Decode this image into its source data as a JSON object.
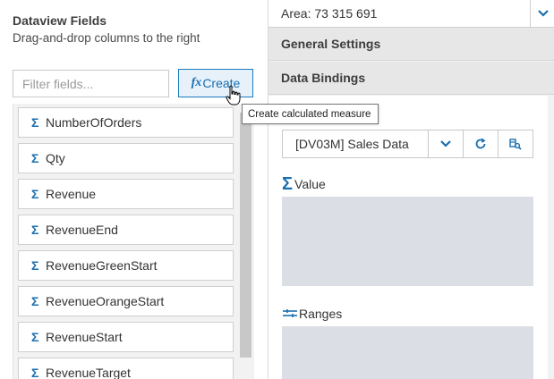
{
  "left": {
    "title": "Dataview Fields",
    "subtitle": "Drag-and-drop columns to the right",
    "filter_placeholder": "Filter fields...",
    "create_label": "Create",
    "create_fx": "fx",
    "fields": [
      "NumberOfOrders",
      "Qty",
      "Revenue",
      "RevenueEnd",
      "RevenueGreenStart",
      "RevenueOrangeStart",
      "RevenueStart",
      "RevenueTarget"
    ],
    "sigma": "Σ"
  },
  "tooltip": "Create calculated measure",
  "right": {
    "area_value": "Area: 73 315 691",
    "sections": {
      "general": "General Settings",
      "bindings": "Data Bindings"
    },
    "datasource": "[DV03M] Sales Data",
    "zones": {
      "value": "Value",
      "ranges": "Ranges"
    }
  },
  "colors": {
    "accent": "#1a6fb0",
    "zone_bg": "#dcdee5"
  }
}
